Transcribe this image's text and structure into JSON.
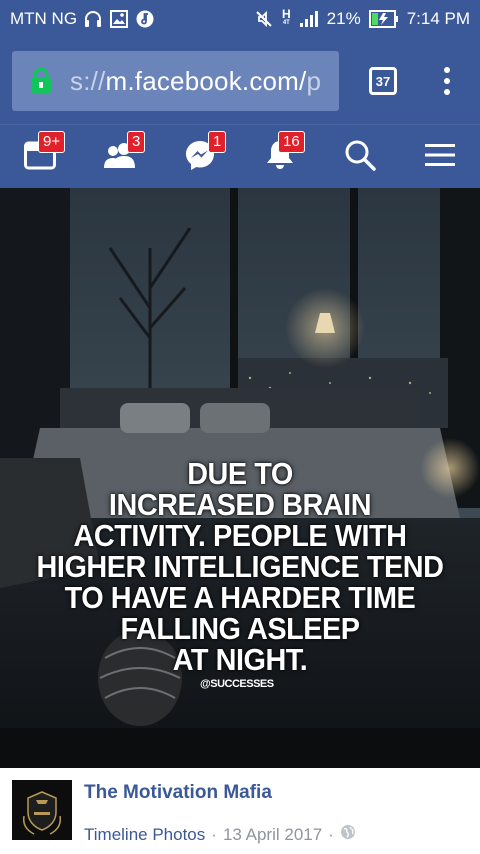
{
  "status": {
    "carrier": "MTN NG",
    "battery_percent": "21%",
    "time": "7:14 PM",
    "network": "H",
    "network_sub": "4T"
  },
  "browser": {
    "url_scheme": "s://",
    "url_host": "m.facebook.com/",
    "url_tail": "p",
    "tab_count": "37"
  },
  "nav": {
    "items": [
      {
        "name": "feed",
        "badge": "9+"
      },
      {
        "name": "friend-requests",
        "badge": "3"
      },
      {
        "name": "messages",
        "badge": "1"
      },
      {
        "name": "notifications",
        "badge": "16"
      },
      {
        "name": "search",
        "badge": ""
      },
      {
        "name": "menu",
        "badge": ""
      }
    ]
  },
  "photo": {
    "quote_lines": [
      "DUE TO",
      "INCREASED BRAIN",
      "ACTIVITY. PEOPLE WITH",
      "HIGHER INTELLIGENCE TEND",
      "TO HAVE A HARDER TIME",
      "FALLING ASLEEP",
      "AT NIGHT."
    ],
    "watermark": "@SUCCESSES"
  },
  "post": {
    "page_name": "The Motivation Mafia",
    "album": "Timeline Photos",
    "separator": "·",
    "date": "13 April 2017",
    "separator2": "·"
  },
  "colors": {
    "brand": "#3b5998",
    "badge": "#e0202a"
  }
}
